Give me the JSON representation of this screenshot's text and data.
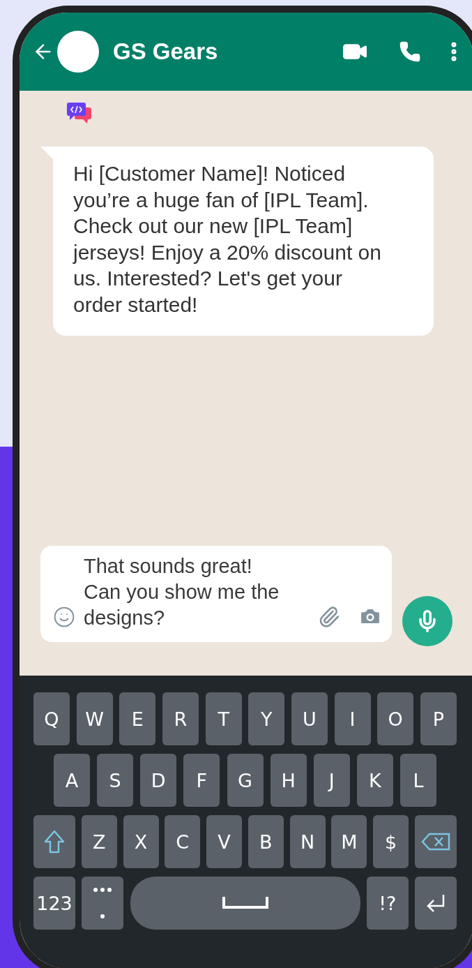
{
  "header": {
    "title": "GS Gears"
  },
  "message": {
    "text": "Hi [Customer Name]! Noticed you’re a huge fan of [IPL Team]. Check out our new [IPL Team] jerseys! Enjoy a 20% discount on us. Interested? Let's get your order started!"
  },
  "composer": {
    "value": "That sounds great! Can you show me the designs?"
  },
  "keyboard": {
    "rows": [
      [
        {
          "kind": "char",
          "label": "Q"
        },
        {
          "kind": "char",
          "label": "W"
        },
        {
          "kind": "char",
          "label": "E"
        },
        {
          "kind": "char",
          "label": "R"
        },
        {
          "kind": "char",
          "label": "T"
        },
        {
          "kind": "char",
          "label": "Y"
        },
        {
          "kind": "char",
          "label": "U"
        },
        {
          "kind": "char",
          "label": "I"
        },
        {
          "kind": "char",
          "label": "O"
        },
        {
          "kind": "char",
          "label": "P"
        }
      ],
      [
        {
          "kind": "char",
          "label": "A"
        },
        {
          "kind": "char",
          "label": "S"
        },
        {
          "kind": "char",
          "label": "D"
        },
        {
          "kind": "char",
          "label": "F"
        },
        {
          "kind": "char",
          "label": "G"
        },
        {
          "kind": "char",
          "label": "H"
        },
        {
          "kind": "char",
          "label": "J"
        },
        {
          "kind": "char",
          "label": "K"
        },
        {
          "kind": "char",
          "label": "L"
        }
      ],
      [
        {
          "kind": "shift"
        },
        {
          "kind": "char",
          "label": "Z"
        },
        {
          "kind": "char",
          "label": "X"
        },
        {
          "kind": "char",
          "label": "C"
        },
        {
          "kind": "char",
          "label": "V"
        },
        {
          "kind": "char",
          "label": "B"
        },
        {
          "kind": "char",
          "label": "N"
        },
        {
          "kind": "char",
          "label": "M"
        },
        {
          "kind": "char",
          "label": "$"
        },
        {
          "kind": "backspace"
        }
      ],
      [
        {
          "kind": "wide",
          "label": "123"
        },
        {
          "kind": "dots"
        },
        {
          "kind": "space"
        },
        {
          "kind": "wide",
          "label": "!?"
        },
        {
          "kind": "enter"
        }
      ]
    ]
  }
}
